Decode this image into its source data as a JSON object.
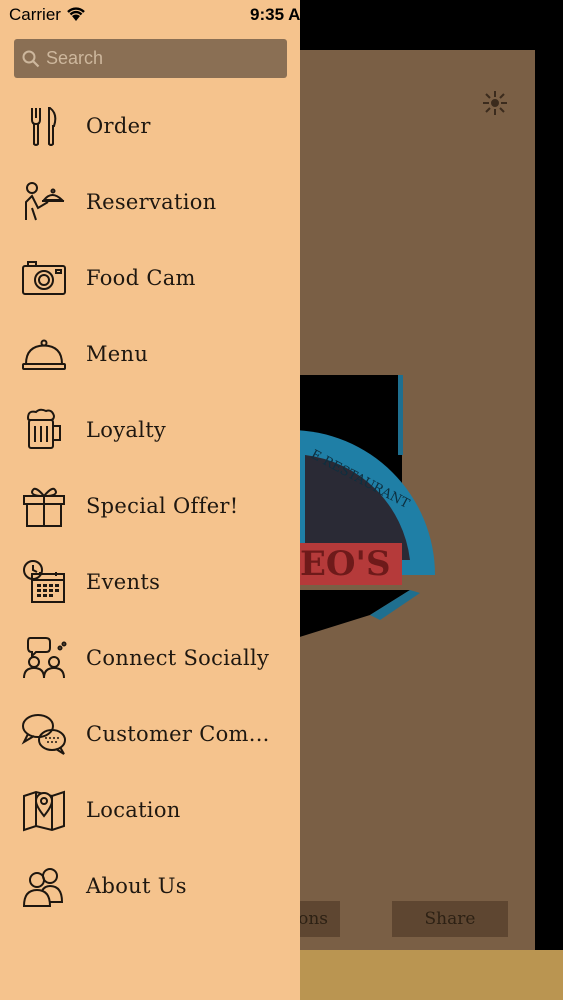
{
  "status_bar": {
    "carrier": "Carrier",
    "time": "9:35 A"
  },
  "search": {
    "placeholder": "Search"
  },
  "menu": {
    "items": [
      {
        "label": "Order",
        "icon": "fork-knife-icon"
      },
      {
        "label": "Reservation",
        "icon": "waiter-icon"
      },
      {
        "label": "Food Cam",
        "icon": "camera-icon"
      },
      {
        "label": "Menu",
        "icon": "cloche-icon"
      },
      {
        "label": "Loyalty",
        "icon": "beer-mug-icon"
      },
      {
        "label": "Special Offer!",
        "icon": "gift-icon"
      },
      {
        "label": "Events",
        "icon": "calendar-clock-icon"
      },
      {
        "label": "Connect Socially",
        "icon": "people-chat-icon"
      },
      {
        "label": "Customer Com...",
        "icon": "speech-bubbles-icon"
      },
      {
        "label": "Location",
        "icon": "map-pin-icon"
      },
      {
        "label": "About Us",
        "icon": "users-icon"
      }
    ]
  },
  "background": {
    "buttons": {
      "left_partial": "ons",
      "share": "Share"
    },
    "logo_text": {
      "arc": "E RESTAURANT",
      "name": "EO'S"
    }
  },
  "colors": {
    "drawer": "#f5c38d",
    "search_bg": "#8a6f54",
    "text": "#1e1710",
    "panel": "#7a5f45",
    "bottom_bar": "#ba9551"
  }
}
